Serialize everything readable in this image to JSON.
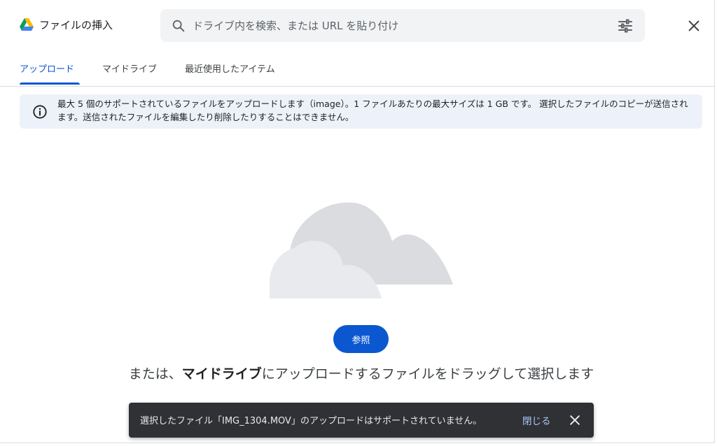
{
  "header": {
    "title": "ファイルの挿入",
    "search_placeholder": "ドライブ内を検索、または URL を貼り付け"
  },
  "tabs": [
    {
      "label": "アップロード",
      "active": true
    },
    {
      "label": "マイドライブ",
      "active": false
    },
    {
      "label": "最近使用したアイテム",
      "active": false
    }
  ],
  "notice": {
    "text": "最大 5 個のサポートされているファイルをアップロードします（image）。1 ファイルあたりの最大サイズは 1 GB です。 選択したファイルのコピーが送信されます。送信されたファイルを編集したり削除したりすることはできません。"
  },
  "upload": {
    "browse_label": "参照",
    "drag_prefix": "または、",
    "drag_bold": "マイドライブ",
    "drag_suffix": "にアップロードするファイルをドラッグして選択します"
  },
  "snackbar": {
    "message": "選択したファイル「IMG_1304.MOV」のアップロードはサポートされていません。",
    "action_label": "閉じる"
  },
  "colors": {
    "accent": "#0b57d0",
    "notice_bg": "#edf2fa",
    "snackbar_bg": "#303134",
    "snackbar_action": "#a8c7fa"
  },
  "icons": [
    "drive-logo-icon",
    "search-icon",
    "filter-icon",
    "close-icon",
    "info-icon",
    "cloud-illustration",
    "snackbar-close-icon"
  ]
}
